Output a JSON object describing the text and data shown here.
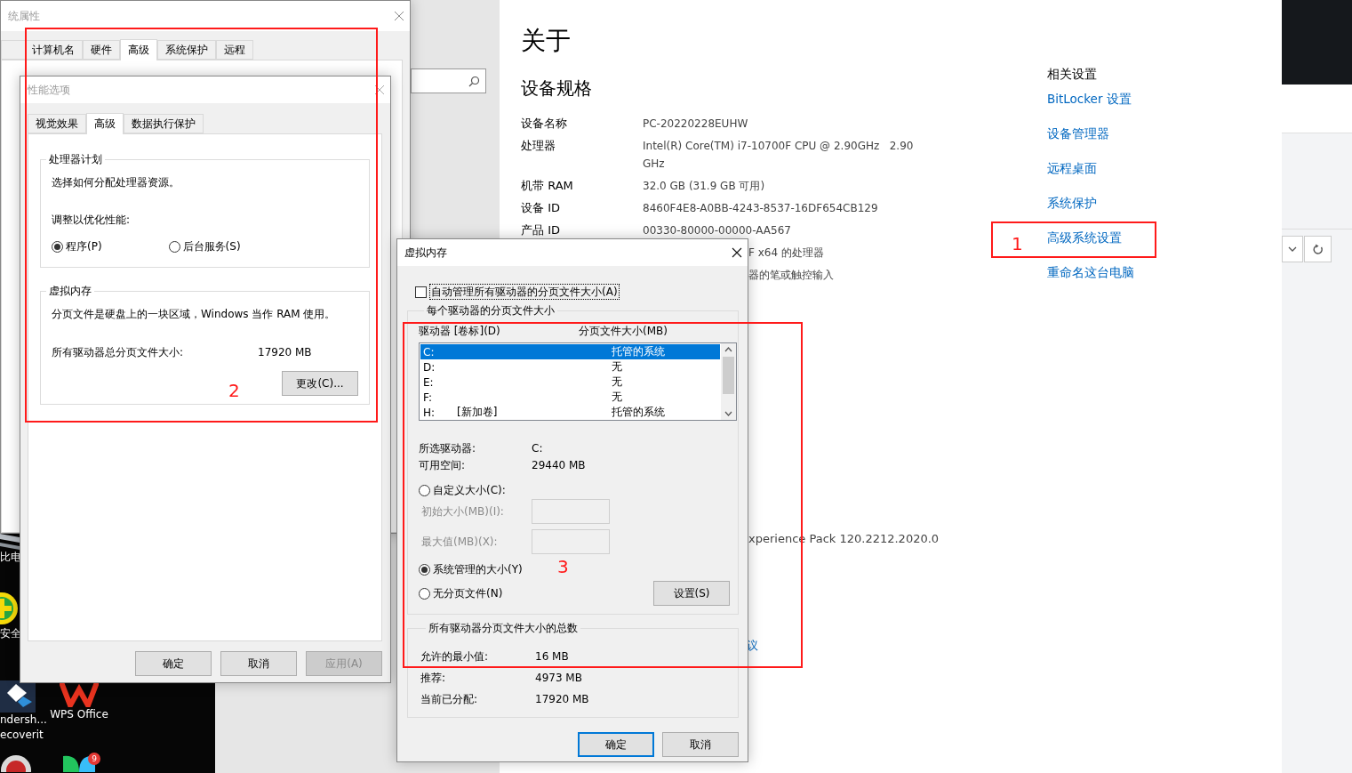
{
  "desktop": {
    "icons": [
      {
        "kind": "laptop",
        "lines": [
          "比电"
        ]
      },
      {
        "kind": "shield",
        "lines": [
          "安全"
        ]
      },
      {
        "kind": "diamond",
        "lines": [
          "ndersh...",
          "ecoverit"
        ]
      },
      {
        "kind": "office",
        "lines": [
          "WPS Office"
        ]
      },
      {
        "kind": "record"
      },
      {
        "kind": "leaf",
        "badge": "9"
      }
    ]
  },
  "settings": {
    "title": "关于",
    "section": "设备规格",
    "specs": [
      {
        "kind": "row",
        "label": "设备名称",
        "value": "PC-20220228EUHW"
      },
      {
        "kind": "row",
        "label": "处理器",
        "value": "Intel(R) Core(TM) i7-10700F CPU @ 2.90GHz   2.90 GHz"
      },
      {
        "kind": "row",
        "label": "机带 RAM",
        "value": "32.0 GB (31.9 GB 可用)"
      },
      {
        "kind": "row",
        "label": "设备 ID",
        "value": "8460F4E8-A0BB-4243-8537-16DF654CB129"
      },
      {
        "kind": "row",
        "label": "产品 ID",
        "value": "00330-80000-00000-AA567"
      },
      {
        "kind": "fragment",
        "value": "F x64 的处理器"
      },
      {
        "kind": "fragment",
        "value": "器的笔或触控输入"
      }
    ],
    "windows_fragment": "xperience Pack 120.2212.2020.0",
    "link_fragment": "议",
    "related": {
      "heading": "相关设置",
      "links": [
        "BitLocker 设置",
        "设备管理器",
        "远程桌面",
        "系统保护",
        "高级系统设置",
        "重命名这台电脑"
      ]
    }
  },
  "system_properties": {
    "title": "统属性",
    "tabs": [
      {
        "label": "计算机名",
        "selected": false
      },
      {
        "label": "硬件",
        "selected": false
      },
      {
        "label": "高级",
        "selected": true
      },
      {
        "label": "系统保护",
        "selected": false
      },
      {
        "label": "远程",
        "selected": false
      }
    ]
  },
  "performance_options": {
    "title": "性能选项",
    "tabs": [
      {
        "label": "视觉效果",
        "selected": false
      },
      {
        "label": "高级",
        "selected": true
      },
      {
        "label": "数据执行保护",
        "selected": false
      }
    ],
    "processor_group": {
      "legend": "处理器计划",
      "description": "选择如何分配处理器资源。",
      "prompt": "调整以优化性能:",
      "options": [
        {
          "label": "程序(P)",
          "selected": true
        },
        {
          "label": "后台服务(S)",
          "selected": false
        }
      ]
    },
    "memory_group": {
      "legend": "虚拟内存",
      "description": "分页文件是硬盘上的一块区域，Windows 当作 RAM 使用。",
      "total_label": "所有驱动器总分页文件大小:",
      "total_value": "17920 MB",
      "button": "更改(C)..."
    },
    "buttons": [
      {
        "label": "确定",
        "disabled": false
      },
      {
        "label": "取消",
        "disabled": false
      },
      {
        "label": "应用(A)",
        "disabled": true
      }
    ]
  },
  "virtual_memory": {
    "title": "虚拟内存",
    "auto_manage": {
      "label": "自动管理所有驱动器的分页文件大小(A)",
      "checked": false
    },
    "per_drive": {
      "legend": "每个驱动器的分页文件大小",
      "columns": [
        "驱动器 [卷标](D)",
        "分页文件大小(MB)"
      ],
      "drives": [
        {
          "drive": "C:",
          "size": "托管的系统",
          "selected": true
        },
        {
          "drive": "D:",
          "size": "无",
          "selected": false
        },
        {
          "drive": "E:",
          "size": "无",
          "selected": false
        },
        {
          "drive": "F:",
          "size": "无",
          "selected": false
        },
        {
          "drive": "H:",
          "volume": "[新加卷]",
          "size": "托管的系统",
          "selected": false
        }
      ],
      "info": [
        {
          "label": "所选驱动器:",
          "value": "C:"
        },
        {
          "label": "可用空间:",
          "value": "29440 MB"
        }
      ],
      "custom": {
        "label": "自定义大小(C):",
        "selected": false
      },
      "fields": [
        {
          "label": "初始大小(MB)(I):",
          "disabled": true
        },
        {
          "label": "最大值(MB)(X):",
          "disabled": true
        }
      ],
      "system_managed": {
        "label": "系统管理的大小(Y)",
        "selected": true
      },
      "no_paging": {
        "label": "无分页文件(N)",
        "selected": false
      },
      "set_button": "设置(S)"
    },
    "totals": {
      "legend": "所有驱动器分页文件大小的总数",
      "rows": [
        {
          "label": "允许的最小值:",
          "value": "16 MB"
        },
        {
          "label": "推荐:",
          "value": "4973 MB"
        },
        {
          "label": "当前已分配:",
          "value": "17920 MB"
        }
      ]
    },
    "buttons": [
      {
        "label": "确定",
        "default": true
      },
      {
        "label": "取消",
        "default": false
      }
    ]
  },
  "annotations": [
    {
      "label": "1"
    },
    {
      "label": "2"
    },
    {
      "label": "3"
    }
  ]
}
